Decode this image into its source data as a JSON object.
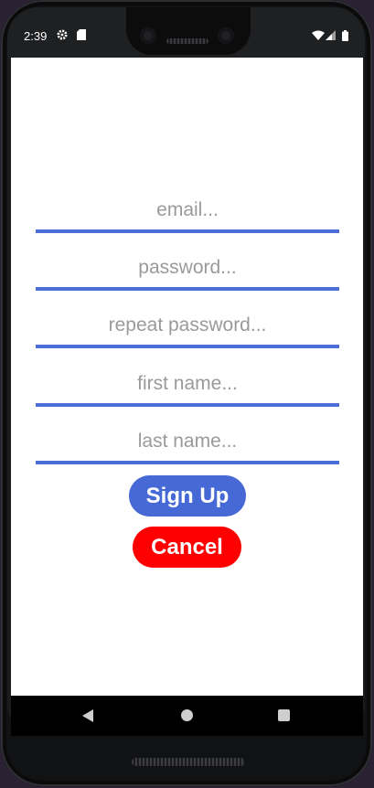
{
  "status_bar": {
    "time": "2:39",
    "icons": [
      "gear-icon",
      "sd-card-icon",
      "wifi-icon",
      "signal-icon",
      "battery-icon"
    ]
  },
  "form": {
    "email_placeholder": "email...",
    "password_placeholder": "password...",
    "repeat_password_placeholder": "repeat password...",
    "first_name_placeholder": "first name...",
    "last_name_placeholder": "last name...",
    "signup_label": "Sign Up",
    "cancel_label": "Cancel"
  },
  "nav": {
    "icons": [
      "back-icon",
      "home-icon",
      "recents-icon"
    ]
  },
  "colors": {
    "accent": "#4a6fd6",
    "signup": "#4669d6",
    "cancel": "#ff0000"
  }
}
